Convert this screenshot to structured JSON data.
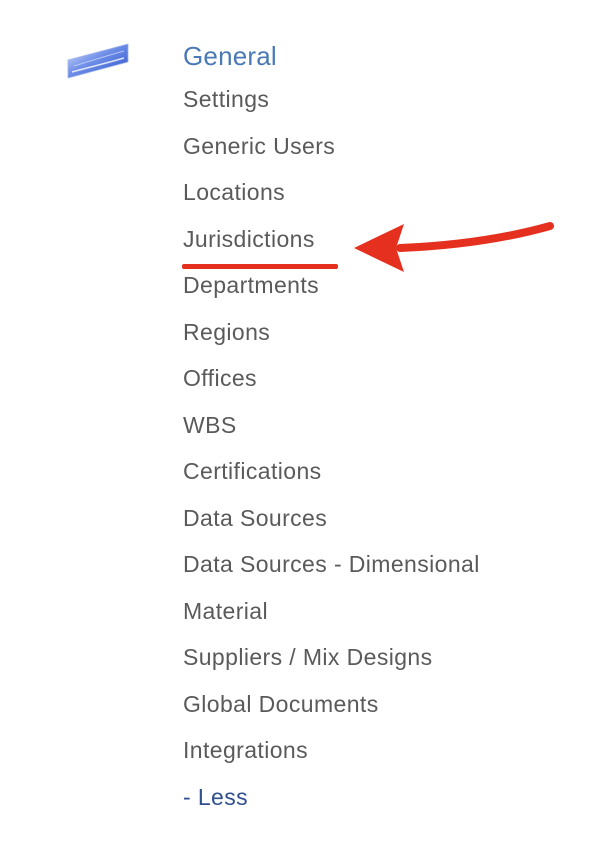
{
  "section": {
    "icon": "ruler-icon",
    "title": "General"
  },
  "menu": {
    "items": [
      {
        "label": "Settings"
      },
      {
        "label": "Generic Users"
      },
      {
        "label": "Locations"
      },
      {
        "label": "Jurisdictions",
        "highlighted": true
      },
      {
        "label": "Departments"
      },
      {
        "label": "Regions"
      },
      {
        "label": "Offices"
      },
      {
        "label": "WBS"
      },
      {
        "label": "Certifications"
      },
      {
        "label": "Data Sources"
      },
      {
        "label": "Data Sources - Dimensional"
      },
      {
        "label": "Material"
      },
      {
        "label": "Suppliers / Mix Designs"
      },
      {
        "label": "Global Documents"
      },
      {
        "label": "Integrations"
      }
    ],
    "toggle_label": "- Less"
  },
  "annotation": {
    "color": "#e5301f"
  }
}
